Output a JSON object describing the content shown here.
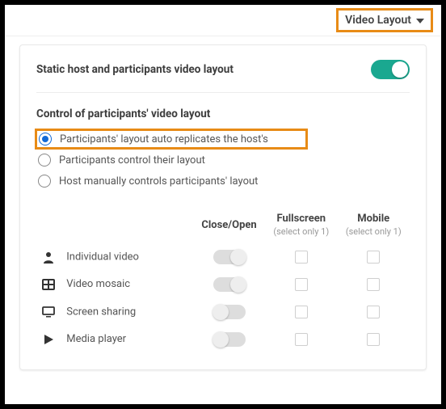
{
  "topbar": {
    "dropdown_label": "Video Layout"
  },
  "panel": {
    "toggle_label": "Static host and participants video layout",
    "toggle_on": true,
    "section_title": "Control of participants' video layout",
    "radios": [
      {
        "label": "Participants' layout auto replicates the host's",
        "checked": true
      },
      {
        "label": "Participants control their layout",
        "checked": false
      },
      {
        "label": "Host manually controls participants' layout",
        "checked": false
      }
    ],
    "columns": {
      "c1": "Close/Open",
      "c2": "Fullscreen",
      "c2_sub": "(select only 1)",
      "c3": "Mobile",
      "c3_sub": "(select only 1)"
    },
    "features": [
      {
        "id": "individual",
        "icon": "user",
        "label": "Individual video",
        "close_open": true,
        "fullscreen": false,
        "mobile": false
      },
      {
        "id": "mosaic",
        "icon": "grid",
        "label": "Video mosaic",
        "close_open": true,
        "fullscreen": false,
        "mobile": false
      },
      {
        "id": "screen",
        "icon": "monitor",
        "label": "Screen sharing",
        "close_open": false,
        "fullscreen": false,
        "mobile": false
      },
      {
        "id": "media",
        "icon": "play",
        "label": "Media player",
        "close_open": false,
        "fullscreen": false,
        "mobile": false
      }
    ]
  }
}
